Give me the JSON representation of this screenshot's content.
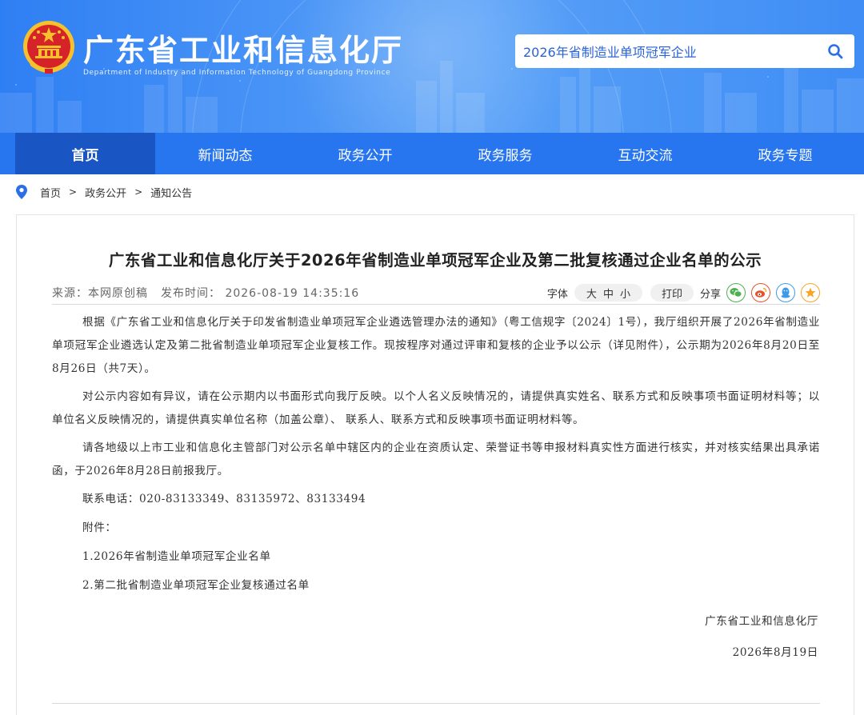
{
  "header": {
    "title": "广东省工业和信息化厅",
    "subtitle": "Department of Industry and Information Technology of Guangdong Province",
    "search_value": "2026年省制造业单项冠军企业"
  },
  "nav": {
    "items": [
      "首页",
      "新闻动态",
      "政务公开",
      "政务服务",
      "互动交流",
      "政务专题"
    ],
    "active": 0
  },
  "breadcrumb": {
    "items": [
      "首页",
      "政务公开",
      "通知公告"
    ],
    "separator": ">"
  },
  "article": {
    "title": "广东省工业和信息化厅关于2026年省制造业单项冠军企业及第二批复核通过企业名单的公示",
    "source": "来源：本网原创稿",
    "publish_time": "发布时间： 2026-08-19 14:35:16",
    "font_label": "字体",
    "font_sizes": [
      "大",
      "中",
      "小"
    ],
    "print_label": "打印",
    "share_label": "分享",
    "paragraphs": [
      "根据《广东省工业和信息化厅关于印发省制造业单项冠军企业遴选管理办法的通知》（粤工信规字〔2024〕1号），我厅组织开展了2026年省制造业单项冠军企业遴选认定及第二批省制造业单项冠军企业复核工作。现按程序对通过评审和复核的企业予以公示（详见附件），公示期为2026年8月20日至8月26日（共7天）。",
      "对公示内容如有异议，请在公示期内以书面形式向我厅反映。以个人名义反映情况的，请提供真实姓名、联系方式和反映事项书面证明材料等；以单位名义反映情况的，请提供真实单位名称（加盖公章）、 联系人、联系方式和反映事项书面证明材料等。",
      "请各地级以上市工业和信息化主管部门对公示名单中辖区内的企业在资质认定、荣誉证书等申报材料真实性方面进行核实，并对核实结果出具承诺函，于2026年8月28日前报我厅。"
    ],
    "contact": "联系电话：020-83133349、83135972、83133494",
    "attachments_label": "附件：",
    "attachments": [
      "1.2026年省制造业单项冠军企业名单",
      "2.第二批省制造业单项冠军企业复核通过名单"
    ],
    "signature": "广东省工业和信息化厅",
    "date": "2026年8月19日"
  },
  "colors": {
    "banner": "#3f8df5",
    "nav": "#2875f0",
    "nav_active": "#1a55c4",
    "wechat": "#4caf50",
    "weibo": "#e6512a",
    "qq": "#3d9be9",
    "favorite": "#f5a623"
  },
  "icons": [
    "national-emblem-icon",
    "search-icon",
    "location-pin-icon",
    "wechat-icon",
    "weibo-icon",
    "qq-icon",
    "star-icon"
  ]
}
